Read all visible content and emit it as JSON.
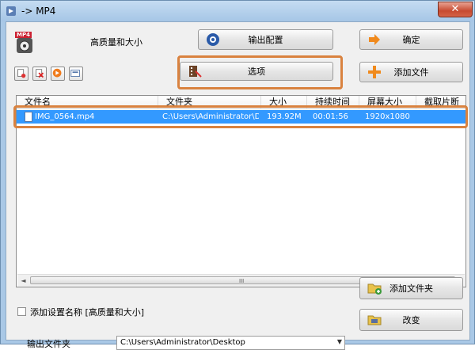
{
  "window": {
    "title": "-> MP4",
    "close_glyph": "✕"
  },
  "header": {
    "logo_badge": "MP4",
    "preset_label": "高质量和大小"
  },
  "buttons": {
    "output_config": "输出配置",
    "ok": "确定",
    "options": "选项",
    "add_file": "添加文件",
    "add_folder": "添加文件夹",
    "change": "改变"
  },
  "table": {
    "columns": [
      "文件名",
      "文件夹",
      "大小",
      "持续时间",
      "屏幕大小",
      "截取片断"
    ],
    "rows": [
      {
        "filename": "IMG_0564.mp4",
        "folder": "C:\\Users\\Administrator\\Des...",
        "size": "193.92M",
        "duration": "00:01:56",
        "resolution": "1920x1080",
        "clip": ""
      }
    ]
  },
  "scrollbar": {
    "left_arrow": "◄",
    "right_arrow": "►",
    "grip": "III"
  },
  "footer": {
    "checkbox_label": "添加设置名称 [高质量和大小]",
    "output_folder_label": "输出文件夹",
    "output_folder_value": "C:\\Users\\Administrator\\Desktop",
    "dropdown_glyph": "▼"
  },
  "colors": {
    "selection": "#3399ff",
    "highlight": "#d9823f",
    "title_bar": "#a9c8e6"
  }
}
